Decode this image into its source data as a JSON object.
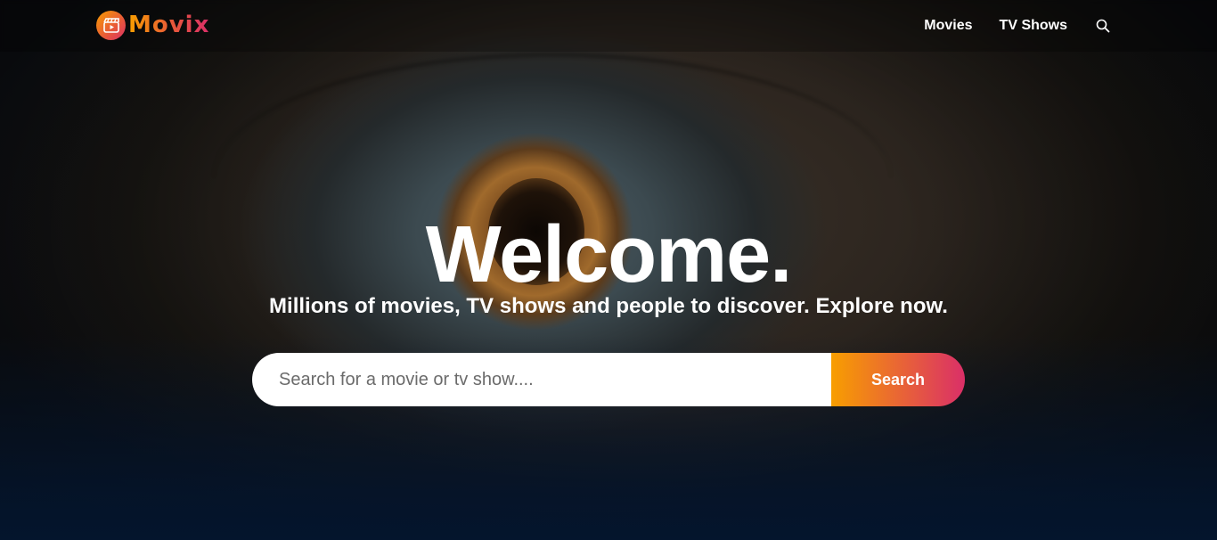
{
  "brand": {
    "name": "Movix",
    "logo_icon": "clapperboard-play-icon",
    "gradient_start": "#f89e00",
    "gradient_end": "#da2f68"
  },
  "nav": {
    "items": [
      {
        "label": "Movies"
      },
      {
        "label": "TV Shows"
      }
    ],
    "search_icon": "search-icon"
  },
  "hero": {
    "title": "Welcome.",
    "subtitle": "Millions of movies, TV shows and people to discover. Explore now.",
    "search": {
      "placeholder": "Search for a movie or tv show....",
      "value": "",
      "button_label": "Search"
    },
    "background_color": "#04152d"
  }
}
